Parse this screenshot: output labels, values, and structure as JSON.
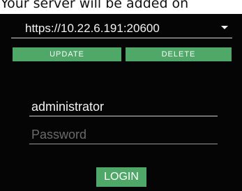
{
  "banner": {
    "text": "Your server will be added on"
  },
  "server": {
    "selected": "https://10.22.6.191:20600"
  },
  "actions": {
    "update_label": "UPDATE",
    "delete_label": "DELETE"
  },
  "login_form": {
    "username_value": "administrator",
    "password_placeholder": "Password",
    "login_label": "LOGIN"
  },
  "colors": {
    "panel_background": "#050505",
    "accent_green": "#4fa768"
  }
}
